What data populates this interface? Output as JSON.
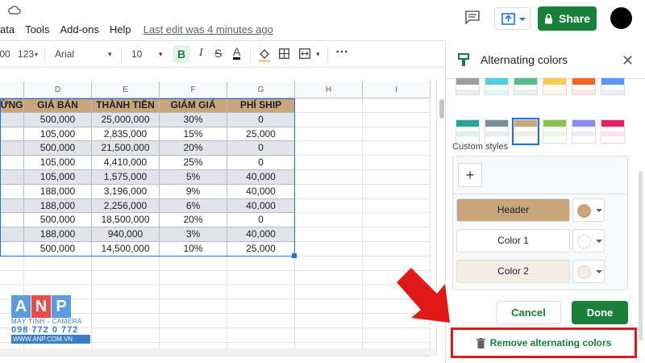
{
  "menu": {
    "items": [
      "ata",
      "Tools",
      "Add-ons",
      "Help"
    ],
    "last_edit": "Last edit was 4 minutes ago"
  },
  "header": {
    "share_label": "Share"
  },
  "toolbar": {
    "decimal": ".00",
    "format": "123",
    "font": "Arial",
    "size": "10",
    "bold": "B"
  },
  "columns": [
    "D",
    "E",
    "F",
    "G",
    "H",
    "I"
  ],
  "table": {
    "first_header": "ỪNG",
    "headers": [
      "GIÁ BÁN",
      "THÀNH TIỀN",
      "GIẢM GIÁ",
      "PHÍ SHIP"
    ],
    "rows": [
      [
        "500,000",
        "25,000,000",
        "30%",
        "0"
      ],
      [
        "105,000",
        "2,835,000",
        "15%",
        "25,000"
      ],
      [
        "500,000",
        "21,500,000",
        "20%",
        "0"
      ],
      [
        "105,000",
        "4,410,000",
        "25%",
        "0"
      ],
      [
        "105,000",
        "1,575,000",
        "5%",
        "40,000"
      ],
      [
        "188,000",
        "3,196,000",
        "9%",
        "40,000"
      ],
      [
        "188,000",
        "2,256,000",
        "6%",
        "40,000"
      ],
      [
        "500,000",
        "18,500,000",
        "20%",
        "0"
      ],
      [
        "188,000",
        "940,000",
        "3%",
        "40,000"
      ],
      [
        "500,000",
        "14,500,000",
        "10%",
        "25,000"
      ]
    ]
  },
  "panel": {
    "title": "Alternating colors",
    "custom_styles": "Custom styles",
    "add": "+",
    "header_label": "Header",
    "color1_label": "Color 1",
    "color2_label": "Color 2",
    "cancel": "Cancel",
    "done": "Done",
    "remove": "Remove alternating colors"
  },
  "colors": {
    "header_fill": "#c8a57a",
    "alt_row": "#e2e4ea",
    "color2": "#f3ede6",
    "accent_green": "#188038",
    "highlight_red": "#e01818"
  },
  "logo": {
    "letters": [
      "A",
      "N",
      "P"
    ],
    "line": "MÁY TÍNH - CAMERA",
    "phone": "098 772 0 772",
    "url": "WWW.ANP.COM.VN"
  }
}
